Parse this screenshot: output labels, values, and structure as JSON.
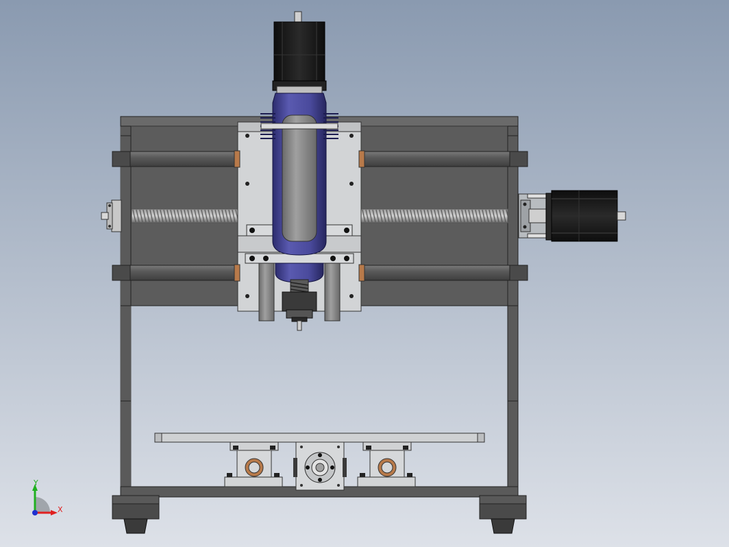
{
  "view": {
    "background_top": "#8a9ab0",
    "background_bottom": "#dde1e8"
  },
  "colors": {
    "frame_dark": "#4f4f4f",
    "frame_mid": "#6b6b6b",
    "frame_edge": "#2a2a2a",
    "rail": "#5e5e5e",
    "aluminum": "#d4d6d8",
    "aluminum_dark": "#a9abae",
    "motor_black": "#1a1a1a",
    "spindle_blue": "#4a4a9c",
    "spindle_blue_dark": "#33337a",
    "spindle_grey": "#8a8a8a",
    "bushing_copper": "#b87a4a",
    "axis_x": "#e02020",
    "axis_y": "#20b020",
    "axis_z": "#2030d0"
  },
  "triad": {
    "x_label": "X",
    "y_label": "Y",
    "icon": "coordinate-triad-icon"
  }
}
